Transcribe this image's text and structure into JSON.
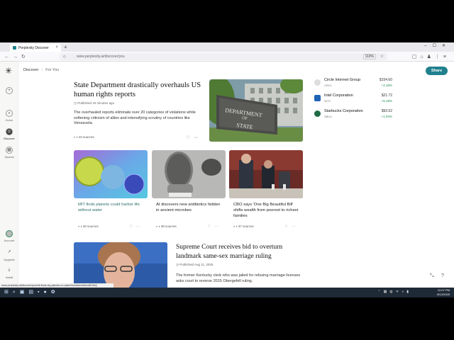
{
  "browser": {
    "tab_title": "Perplexity Discover",
    "tab_close": "×",
    "new_tab": "+",
    "url": "www.perplexity.ai/discover/you",
    "zoom": "110%"
  },
  "sidebar": {
    "new": "+",
    "items": [
      {
        "label": "Home",
        "icon": "home-icon"
      },
      {
        "label": "Discover",
        "icon": "globe-icon"
      },
      {
        "label": "Spaces",
        "icon": "spaces-icon"
      },
      {
        "label": "Account",
        "icon": "avatar"
      },
      {
        "label": "Upgrade",
        "icon": "upgrade-icon"
      },
      {
        "label": "Install",
        "icon": "install-icon"
      }
    ]
  },
  "breadcrumb": {
    "root": "Discover",
    "current": "For You"
  },
  "share_label": "Share",
  "hero": {
    "title": "State Department drastically overhauls US human rights reports",
    "time": "Published 15 minutes ago",
    "desc": "The overhauled reports eliminate over 20 categories of violations while softening criticism of allies and intensifying scrutiny of countries like Venezuela.",
    "sources": "43 sources",
    "sign_line1": "DEPARTMENT",
    "sign_line2": "OF",
    "sign_line3": "STATE"
  },
  "stocks": [
    {
      "name": "Circle Internet Group",
      "ticker": "CRCL",
      "price": "$154.60",
      "change": "+2.18%",
      "color": "#bbbbbb"
    },
    {
      "name": "Intel Corporation",
      "ticker": "INTC",
      "price": "$21.72",
      "change": "+5.18%",
      "color": "#1e63b5"
    },
    {
      "name": "Starbucks Corporation",
      "ticker": "SBUX",
      "price": "$93.52",
      "change": "+1.94%",
      "color": "#1e6b44"
    }
  ],
  "cards": [
    {
      "title": "MIT finds planets could harbor life without water",
      "sources": "40 sources"
    },
    {
      "title": "AI discovers new antibiotics hidden in ancient microbes",
      "sources": "39 sources"
    },
    {
      "title": "CBO says 'One Big Beautiful Bill' shifts wealth from poorest to richest families",
      "sources": "37 sources"
    }
  ],
  "bottom": {
    "title": "Supreme Court receives bid to overturn landmark same-sex marriage ruling",
    "time": "Published Aug 11, 2025",
    "desc": "The former Kentucky clerk who was jailed for refusing marriage licenses asks court to reverse 2015 Obergefell ruling."
  },
  "status_url": "www.perplexity.ai/discover/you/mit-finds-dry-planets-no-water/0wnMaVs6MwdEGfhQ",
  "clock": {
    "time": "12:07 PM",
    "date": "8/12/2025"
  }
}
